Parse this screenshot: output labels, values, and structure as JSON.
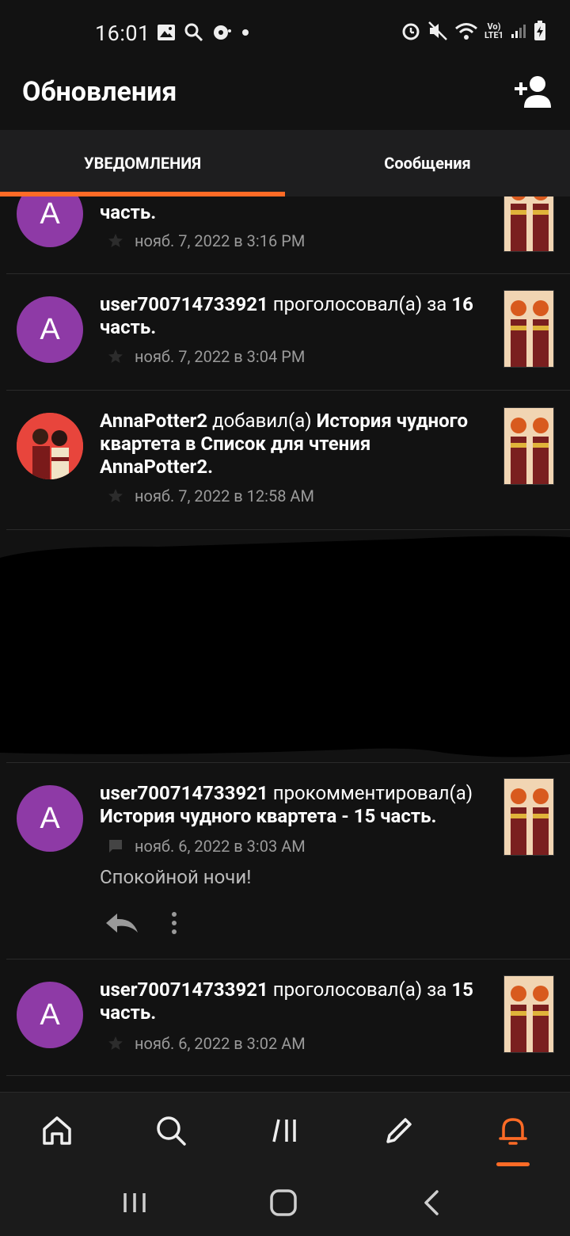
{
  "status_bar": {
    "time": "16:01",
    "lte_label_top": "Vo)",
    "lte_label_bottom": "LTE1"
  },
  "header": {
    "title": "Обновления"
  },
  "tabs": [
    {
      "label": "УВЕДОМЛЕНИЯ",
      "active": true
    },
    {
      "label": "Сообщения",
      "active": false
    }
  ],
  "notifications": [
    {
      "avatar_letter": "A",
      "line_end": "часть.",
      "time": "нояб. 7, 2022 в 3:16 PM"
    },
    {
      "avatar_letter": "A",
      "user": "user700714733921",
      "action": "проголосовал(а) за",
      "number": "16",
      "line_end": "часть.",
      "time": "нояб. 7, 2022 в 3:04 PM"
    },
    {
      "user": "AnnaPotter2",
      "action": "добавил(а)",
      "story": "История чудного квартета в Список для чтения AnnaPotter2.",
      "time": "нояб. 7, 2022 в 12:58 AM"
    },
    {
      "avatar_letter": "A",
      "user": "user700714733921",
      "action": "прокомментировал(а)",
      "story": "История чудного квартета - 15 часть.",
      "time": "нояб. 6, 2022 в 3:03 AM",
      "comment": "Спокойной ночи!"
    },
    {
      "avatar_letter": "A",
      "user": "user700714733921",
      "action": "проголосовал(а) за",
      "number": "15",
      "line_end": "часть.",
      "time": "нояб. 6, 2022 в 3:02 AM"
    }
  ],
  "colors": {
    "accent": "#ff6b26",
    "avatar_purple": "#8e3aa6",
    "background": "#121212"
  }
}
